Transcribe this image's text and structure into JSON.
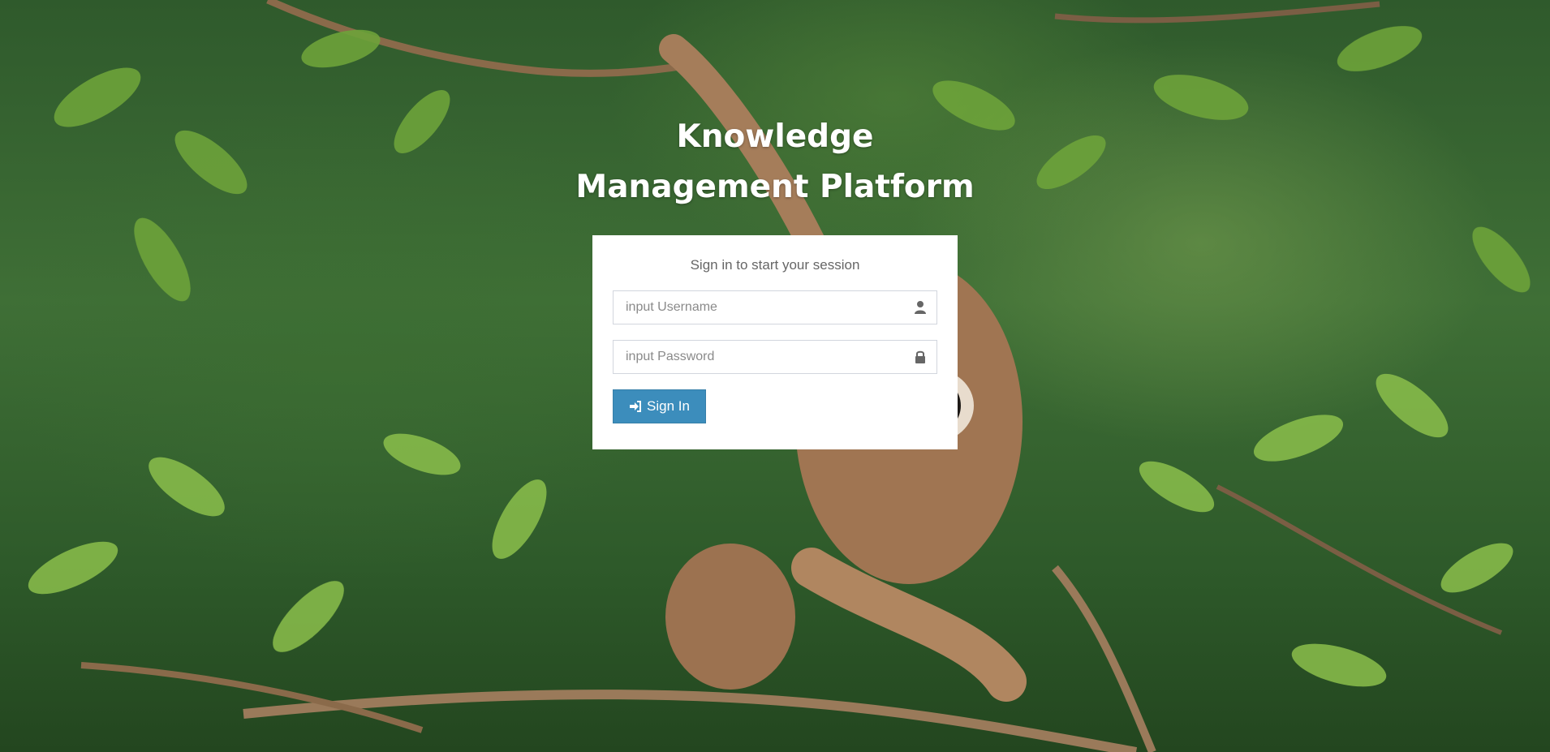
{
  "page": {
    "title_line1": "Knowledge",
    "title_line2": "Management Platform"
  },
  "login": {
    "message": "Sign in to start your session",
    "username_placeholder": "input Username",
    "username_value": "",
    "username_icon": "user-icon",
    "password_placeholder": "input Password",
    "password_value": "",
    "password_icon": "lock-icon",
    "signin_label": "Sign In",
    "signin_icon": "sign-in-icon"
  },
  "colors": {
    "primary_button": "#3c8dbc",
    "box_background": "#ffffff",
    "title_text": "#ffffff"
  }
}
